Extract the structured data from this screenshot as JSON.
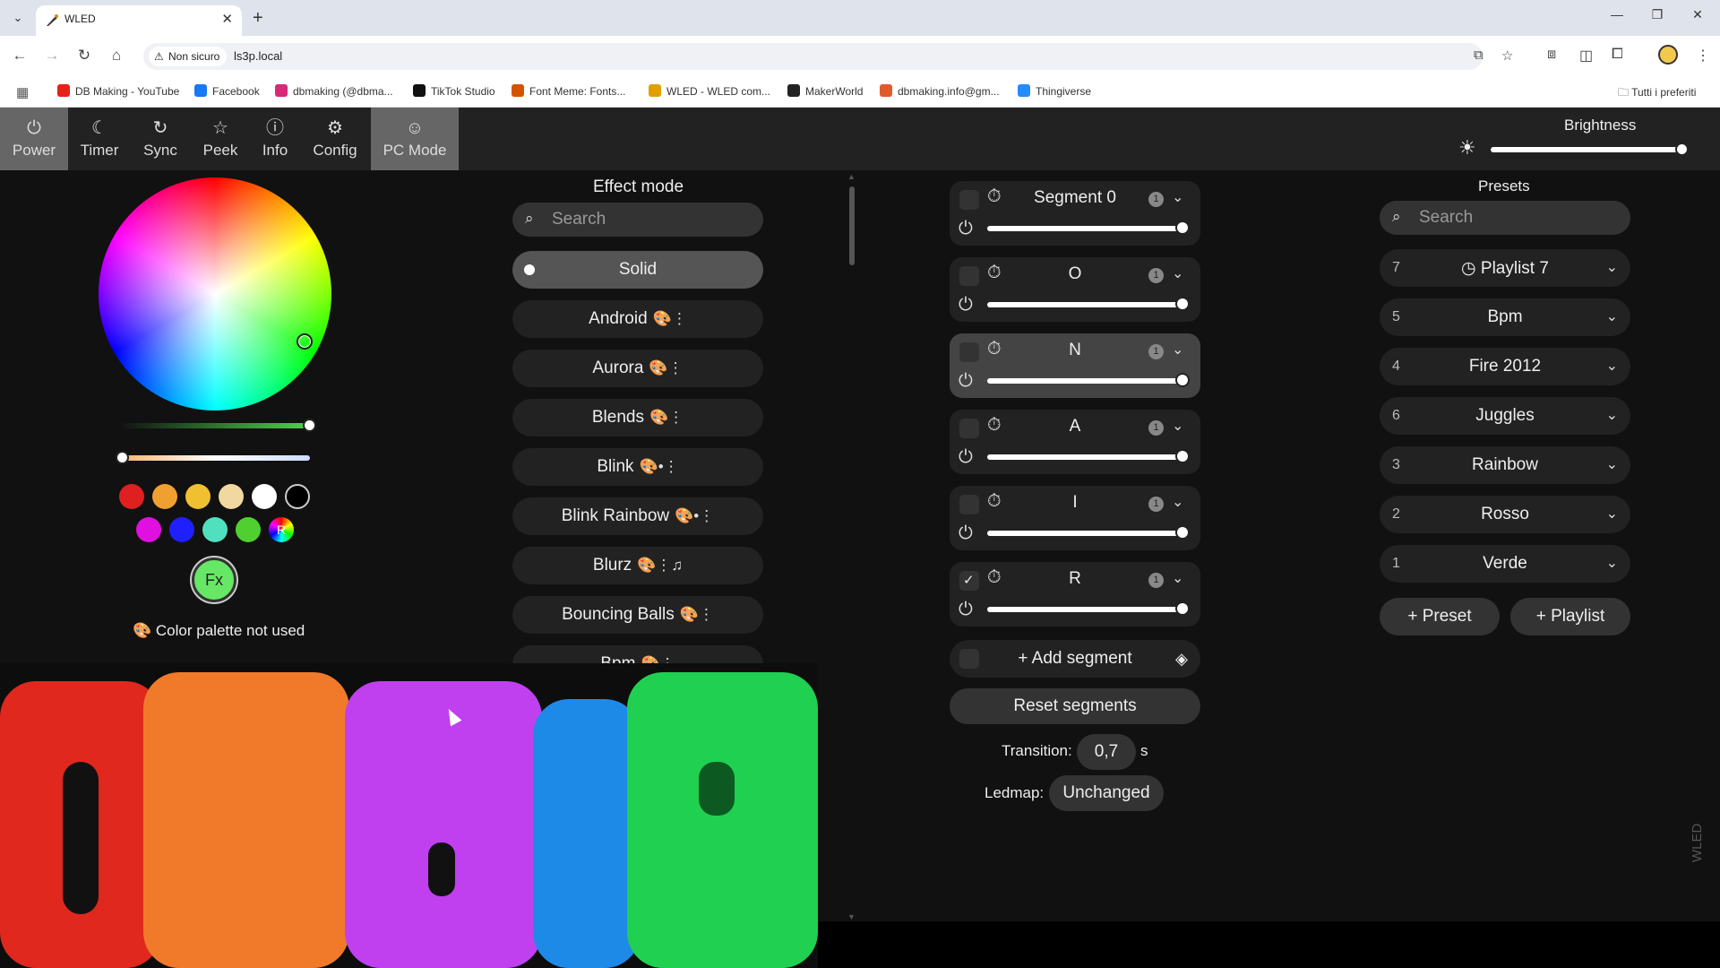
{
  "browser": {
    "tab_title": "WLED",
    "security_label": "Non sicuro",
    "url": "ls3p.local",
    "bookmarks": [
      {
        "label": "DB Making - YouTube",
        "color": "#e62117"
      },
      {
        "label": "Facebook",
        "color": "#1877f2"
      },
      {
        "label": "dbmaking (@dbma...",
        "color": "#d62976"
      },
      {
        "label": "TikTok Studio",
        "color": "#111111"
      },
      {
        "label": "Font Meme: Fonts...",
        "color": "#d35400"
      },
      {
        "label": "WLED - WLED com...",
        "color": "#e0a100"
      },
      {
        "label": "MakerWorld",
        "color": "#222222"
      },
      {
        "label": "dbmaking.info@gm...",
        "color": "#e05a2b"
      },
      {
        "label": "Thingiverse",
        "color": "#248bfb"
      }
    ],
    "all_bookmarks": "Tutti i preferiti"
  },
  "topbar": {
    "buttons": [
      {
        "label": "Power",
        "icon": "power-icon",
        "active": true
      },
      {
        "label": "Timer",
        "icon": "moon-icon",
        "active": false
      },
      {
        "label": "Sync",
        "icon": "sync-icon",
        "active": false
      },
      {
        "label": "Peek",
        "icon": "star-icon",
        "active": false
      },
      {
        "label": "Info",
        "icon": "info-icon",
        "active": false
      },
      {
        "label": "Config",
        "icon": "gear-icon",
        "active": false
      },
      {
        "label": "PC Mode",
        "icon": "smiley-icon",
        "active": true
      }
    ],
    "brightness_label": "Brightness",
    "brightness": 1.0
  },
  "color": {
    "quick_colors": [
      "#e02020",
      "#f0a030",
      "#f0c030",
      "#f0d8a0",
      "#ffffff",
      "#000000",
      "#e010e0",
      "#2020ff",
      "#50e0c0",
      "#50d030"
    ],
    "random_label": "R",
    "fx_label": "Fx",
    "palette_note": "Color palette not used"
  },
  "effects": {
    "title": "Effect mode",
    "search_placeholder": "Search",
    "items": [
      {
        "name": "Solid",
        "flags": "",
        "selected": true
      },
      {
        "name": "Android",
        "flags": "🎨⋮"
      },
      {
        "name": "Aurora",
        "flags": "🎨⋮"
      },
      {
        "name": "Blends",
        "flags": "🎨⋮"
      },
      {
        "name": "Blink",
        "flags": "🎨•⋮"
      },
      {
        "name": "Blink Rainbow",
        "flags": "🎨•⋮"
      },
      {
        "name": "Blurz",
        "flags": "🎨⋮♫"
      },
      {
        "name": "Bouncing Balls",
        "flags": "🎨⋮"
      },
      {
        "name": "Bpm",
        "flags": "🎨⋮"
      }
    ]
  },
  "segments": {
    "items": [
      {
        "name": "Segment 0",
        "checked": false,
        "badge": "1"
      },
      {
        "name": "O",
        "checked": false,
        "badge": "1"
      },
      {
        "name": "N",
        "checked": false,
        "badge": "1",
        "highlight": true
      },
      {
        "name": "A",
        "checked": false,
        "badge": "1"
      },
      {
        "name": "I",
        "checked": false,
        "badge": "1"
      },
      {
        "name": "R",
        "checked": true,
        "badge": "1"
      }
    ],
    "add_label": "Add segment",
    "reset_label": "Reset segments",
    "transition_label": "Transition:",
    "transition_value": "0,7",
    "transition_unit": "s",
    "ledmap_label": "Ledmap:",
    "ledmap_value": "Unchanged"
  },
  "presets": {
    "title": "Presets",
    "search_placeholder": "Search",
    "items": [
      {
        "id": "7",
        "name": "Playlist 7",
        "playlist": true
      },
      {
        "id": "5",
        "name": "Bpm"
      },
      {
        "id": "4",
        "name": "Fire 2012"
      },
      {
        "id": "6",
        "name": "Juggles"
      },
      {
        "id": "3",
        "name": "Rainbow"
      },
      {
        "id": "2",
        "name": "Rosso"
      },
      {
        "id": "1",
        "name": "Verde"
      }
    ],
    "add_preset": "Preset",
    "add_playlist": "Playlist"
  },
  "footer": {
    "vertical_brand": "WLED"
  }
}
